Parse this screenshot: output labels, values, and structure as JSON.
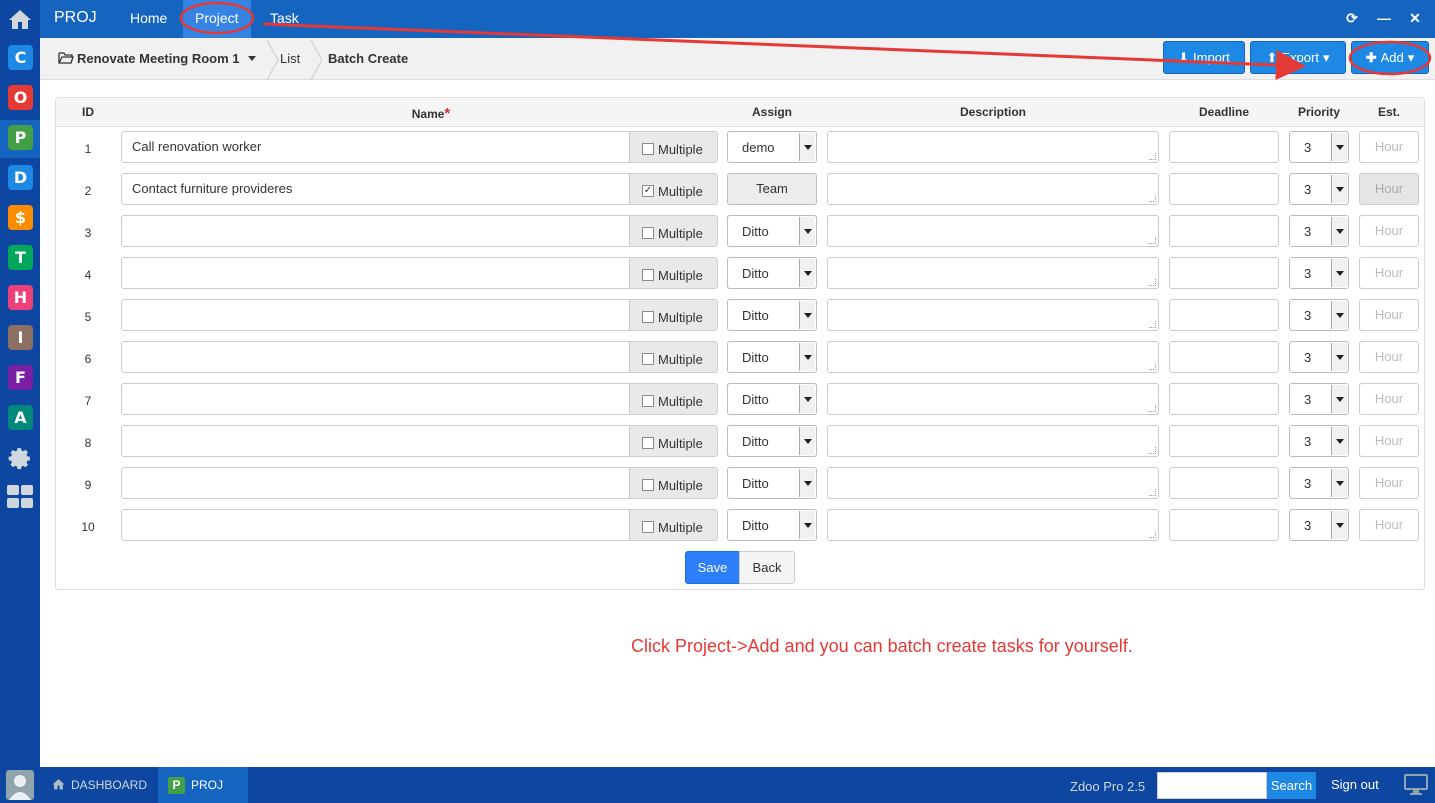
{
  "app": {
    "brand": "PROJ"
  },
  "topnav": {
    "home": "Home",
    "project": "Project",
    "task": "Task"
  },
  "window_controls": {
    "refresh": "⟳",
    "minimize": "—",
    "close": "✕"
  },
  "dock": {
    "tiles": [
      {
        "letter": "C",
        "color": "#1e88e5"
      },
      {
        "letter": "O",
        "color": "#e53935"
      },
      {
        "letter": "P",
        "color": "#43a047"
      },
      {
        "letter": "D",
        "color": "#1e88e5"
      },
      {
        "letter": "$",
        "color": "#fb8c00"
      },
      {
        "letter": "T",
        "color": "#00a65a"
      },
      {
        "letter": "H",
        "color": "#ec407a"
      },
      {
        "letter": "I",
        "color": "#8d6e63"
      },
      {
        "letter": "F",
        "color": "#7b1fa2"
      },
      {
        "letter": "A",
        "color": "#00897b"
      }
    ]
  },
  "breadcrumb": {
    "project": "Renovate Meeting Room 1",
    "list": "List",
    "current": "Batch Create"
  },
  "toolbar": {
    "import": "Import",
    "export": "Export",
    "add": "Add"
  },
  "table": {
    "headers": {
      "id": "ID",
      "name": "Name",
      "required": "*",
      "assign": "Assign",
      "description": "Description",
      "deadline": "Deadline",
      "priority": "Priority",
      "est": "Est."
    },
    "multiple_label": "Multiple",
    "est_placeholder": "Hour",
    "team_label": "Team",
    "rows": [
      {
        "id": "1",
        "name": "Call renovation worker",
        "multiple": false,
        "assign": "demo",
        "priority": "3"
      },
      {
        "id": "2",
        "name": "Contact furniture provideres",
        "multiple": true,
        "assign": "",
        "priority": "3"
      },
      {
        "id": "3",
        "name": "",
        "multiple": false,
        "assign": "Ditto",
        "priority": "3"
      },
      {
        "id": "4",
        "name": "",
        "multiple": false,
        "assign": "Ditto",
        "priority": "3"
      },
      {
        "id": "5",
        "name": "",
        "multiple": false,
        "assign": "Ditto",
        "priority": "3"
      },
      {
        "id": "6",
        "name": "",
        "multiple": false,
        "assign": "Ditto",
        "priority": "3"
      },
      {
        "id": "7",
        "name": "",
        "multiple": false,
        "assign": "Ditto",
        "priority": "3"
      },
      {
        "id": "8",
        "name": "",
        "multiple": false,
        "assign": "Ditto",
        "priority": "3"
      },
      {
        "id": "9",
        "name": "",
        "multiple": false,
        "assign": "Ditto",
        "priority": "3"
      },
      {
        "id": "10",
        "name": "",
        "multiple": false,
        "assign": "Ditto",
        "priority": "3"
      }
    ]
  },
  "actions": {
    "save": "Save",
    "back": "Back"
  },
  "tip": "Click Project->Add and you can batch create tasks for yourself.",
  "footer": {
    "dashboard": "DASHBOARD",
    "proj": "PROJ",
    "version": "Zdoo Pro 2.5",
    "search": "Search",
    "signout": "Sign out"
  },
  "colors": {
    "annotation": "#e53935",
    "topbar": "#1565c0",
    "dock": "#0d47a1"
  }
}
